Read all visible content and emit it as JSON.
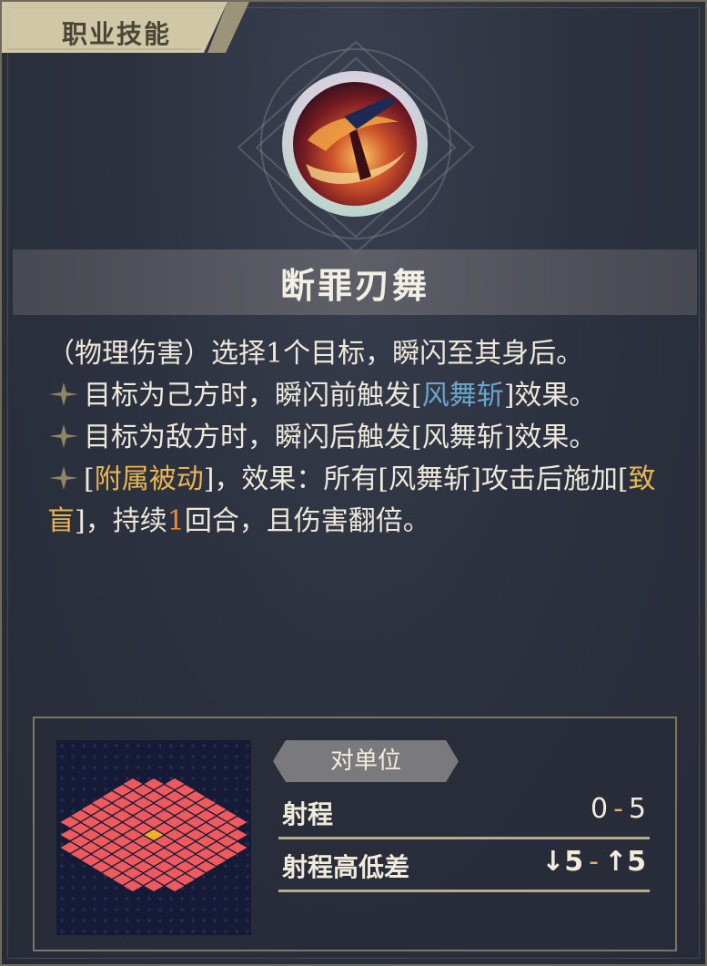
{
  "header": {
    "tab_label": "职业技能"
  },
  "skill": {
    "icon": "crescent-blade-skill-icon",
    "name": "断罪刃舞"
  },
  "description": {
    "line1": "（物理伤害）选择1个目标，瞬闪至其身后。",
    "bullet1": {
      "pre": "目标为己方时，瞬闪前触发[",
      "keyword": "风舞斩",
      "post": "]效果。"
    },
    "bullet2": {
      "text": "目标为敌方时，瞬闪后触发[风舞斩]效果。"
    },
    "bullet3": {
      "pre": "[",
      "keyword": "附属被动",
      "mid1": "]，效果：所有[风舞斩]攻击后施加[",
      "keyword2": "致盲",
      "mid2": "]，持续",
      "number": "1",
      "post": "回合，且伤害翻倍。"
    }
  },
  "range_panel": {
    "target_type": "对单位",
    "rows": [
      {
        "name": "射程",
        "min": "0",
        "sep": "-",
        "max": "5"
      },
      {
        "name": "射程高低差",
        "min": "↓5",
        "sep": "-",
        "max": "↑5"
      }
    ]
  },
  "colors": {
    "keyword_blue": "#6aa6cc",
    "keyword_gold": "#e7b552",
    "number_orange": "#e58a3c",
    "range_tile": "#ef5a5e",
    "center_tile": "#f0b020"
  }
}
